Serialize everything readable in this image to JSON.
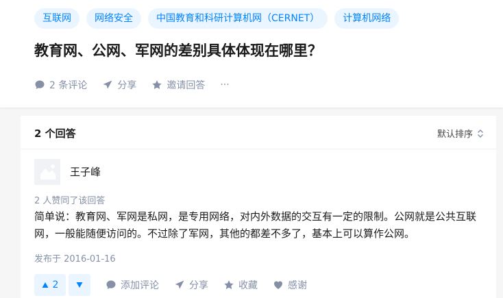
{
  "question": {
    "tags": [
      "互联网",
      "网络安全",
      "中国教育和科研计算机网（CERNET）",
      "计算机网络"
    ],
    "title": "教育网、公网、军网的差别具体体现在哪里？",
    "actions": {
      "comments": "2 条评论",
      "share": "分享",
      "invite": "邀请回答",
      "more": "···"
    }
  },
  "answers": {
    "count_label": "2 个回答",
    "sort_label": "默认排序",
    "items": [
      {
        "author": "王子峰",
        "votes_line": "2 人赞同了该回答",
        "content": "简单说：教育网、军网是私网，是专用网络，对内外数据的交互有一定的限制。公网就是公共互联网，一般能随便访问的。不过除了军网，其他的都差不多了，基本上可以算作公网。",
        "published": "发布于 2016-01-16",
        "upvotes": "2",
        "add_comment": "添加评论",
        "share": "分享",
        "favorite": "收藏",
        "thanks": "感谢"
      }
    ]
  },
  "colors": {
    "accent": "#0084ff",
    "tag_bg": "#ebf5ff",
    "muted": "#8590a6"
  }
}
